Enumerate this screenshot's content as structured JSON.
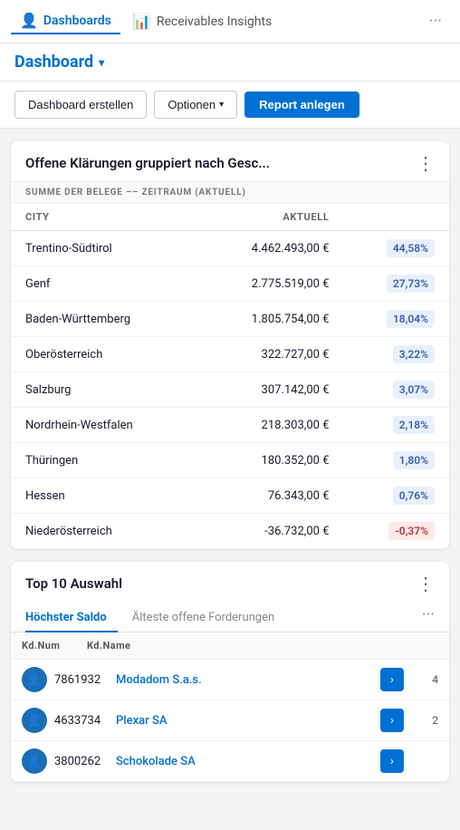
{
  "nav": {
    "items": [
      {
        "id": "dashboards",
        "label": "Dashboards",
        "icon": "👤",
        "active": true
      },
      {
        "id": "receivables",
        "label": "Receivables Insights",
        "icon": "📊",
        "active": false
      }
    ],
    "more_label": "···"
  },
  "header": {
    "title": "Dashboard",
    "dropdown_char": "▾"
  },
  "toolbar": {
    "btn_create": "Dashboard erstellen",
    "btn_options": "Optionen",
    "btn_options_arrow": "▾",
    "btn_report": "Report anlegen"
  },
  "card1": {
    "title": "Offene Klärungen gruppiert nach Gesc...",
    "menu_icon": "⋮",
    "section_label": "SUMME DER BELEGE –– ZEITRAUM (AKTUELL)",
    "col_city": "CITY",
    "col_aktuell": "AKTUELL",
    "rows": [
      {
        "city": "Trentino-Südtirol",
        "value": "4.462.493,00 €",
        "percent": "44,58%",
        "negative": false
      },
      {
        "city": "Genf",
        "value": "2.775.519,00 €",
        "percent": "27,73%",
        "negative": false
      },
      {
        "city": "Baden-Württemberg",
        "value": "1.805.754,00 €",
        "percent": "18,04%",
        "negative": false
      },
      {
        "city": "Oberösterreich",
        "value": "322.727,00 €",
        "percent": "3,22%",
        "negative": false
      },
      {
        "city": "Salzburg",
        "value": "307.142,00 €",
        "percent": "3,07%",
        "negative": false
      },
      {
        "city": "Nordrhein-Westfalen",
        "value": "218.303,00 €",
        "percent": "2,18%",
        "negative": false
      },
      {
        "city": "Thüringen",
        "value": "180.352,00 €",
        "percent": "1,80%",
        "negative": false
      },
      {
        "city": "Hessen",
        "value": "76.343,00 €",
        "percent": "0,76%",
        "negative": false
      },
      {
        "city": "Niederösterreich",
        "value": "-36.732,00 €",
        "percent": "-0,37%",
        "negative": true
      }
    ]
  },
  "card2": {
    "title": "Top 10 Auswahl",
    "menu_icon": "⋮",
    "tabs": [
      {
        "id": "hoechster",
        "label": "Höchster Saldo",
        "active": true
      },
      {
        "id": "aelteste",
        "label": "Älteste offene Forderungen",
        "active": false
      }
    ],
    "more_label": "···",
    "col_kdnum": "Kd.Num",
    "col_kdname": "Kd.Name",
    "rows": [
      {
        "id": "7861932",
        "name": "Modadom S.a.s.",
        "amount": "4",
        "avatar_icon": "👤"
      },
      {
        "id": "4633734",
        "name": "Plexar SA",
        "amount": "2",
        "avatar_icon": "👤"
      },
      {
        "id": "3800262",
        "name": "Schokolade SA",
        "amount": "",
        "avatar_icon": "👤"
      }
    ]
  }
}
